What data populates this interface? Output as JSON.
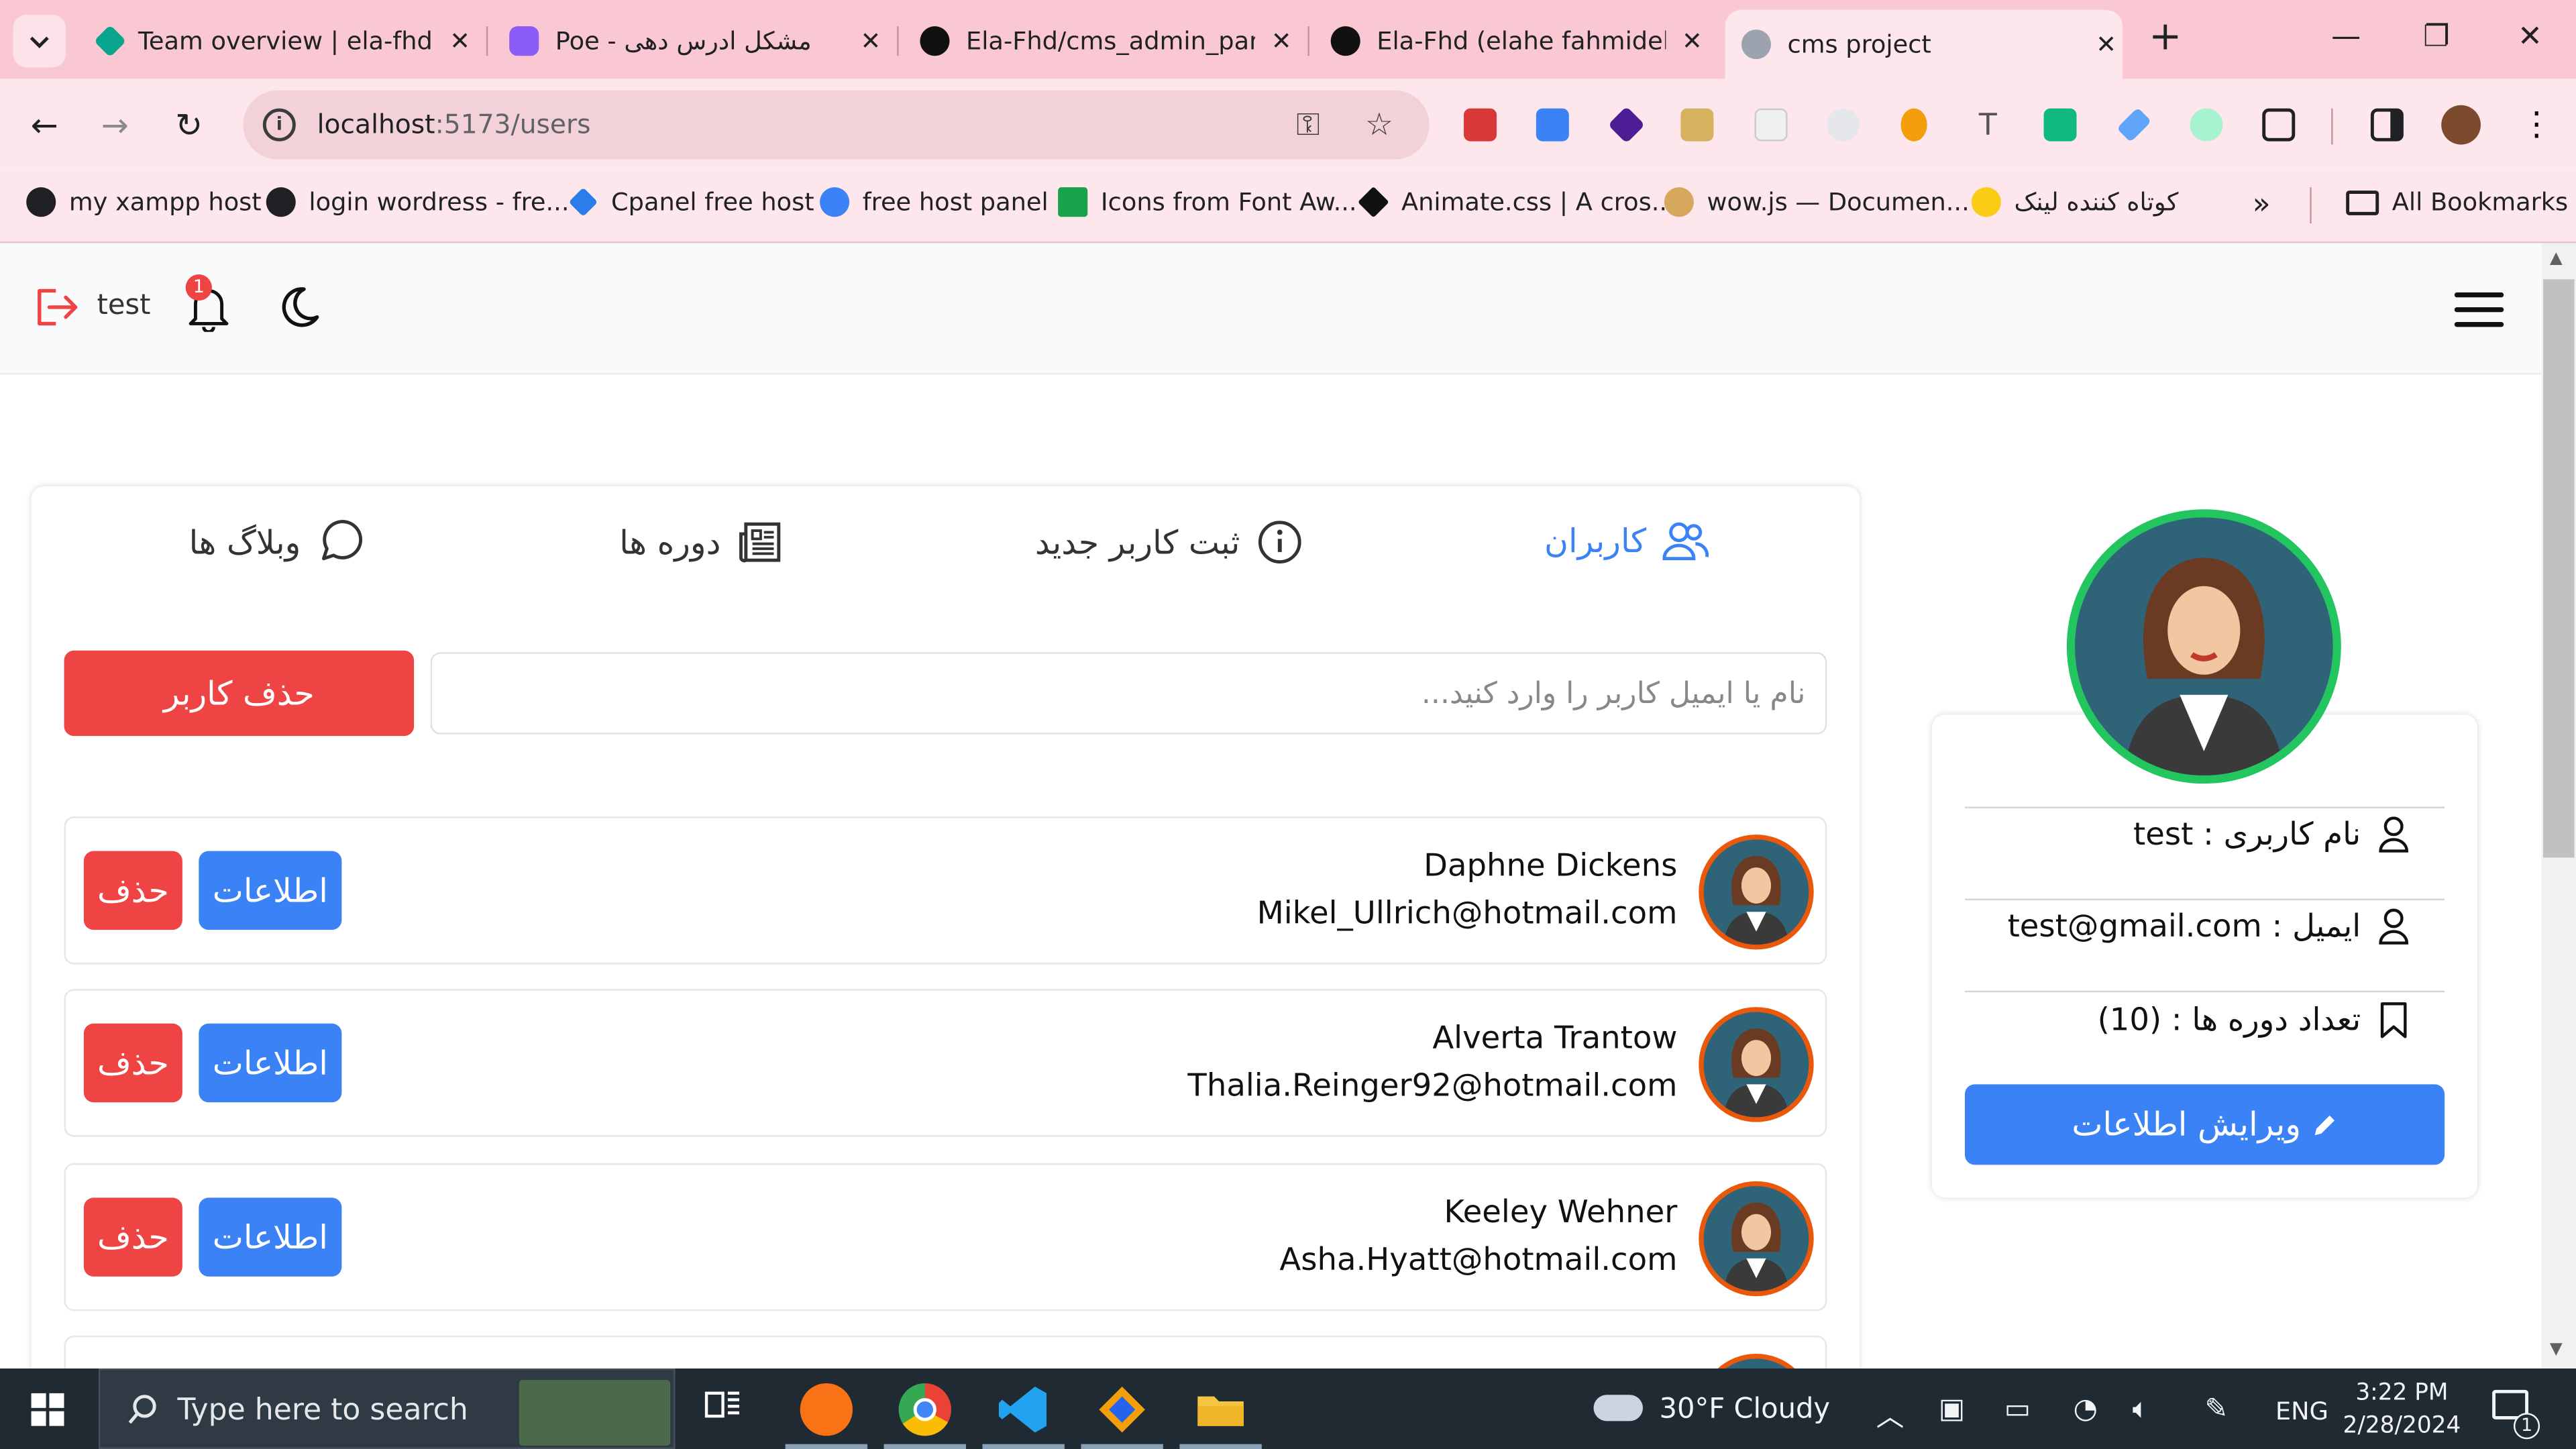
{
  "browser": {
    "tabs": [
      {
        "title": "Team overview | ela-fhd |",
        "color": "#0aa58f"
      },
      {
        "title": "Poe - مشکل ادرس دهی",
        "color": "#8b5cf6"
      },
      {
        "title": "Ela-Fhd/cms_admin_pane",
        "color": "#111111"
      },
      {
        "title": "Ela-Fhd (elahe fahmideh)",
        "color": "#111111"
      },
      {
        "title": "cms project",
        "color": "#9ca3af"
      }
    ],
    "url_host": "localhost",
    "url_path": ":5173/users",
    "bookmarks": [
      "my xampp host",
      "login wordress - fre...",
      "Cpanel free host",
      "free host panel",
      "Icons from Font Aw...",
      "Animate.css | A cros...",
      "wow.js — Documen...",
      "کوتاه کننده لینک"
    ],
    "all_bookmarks": "All Bookmarks",
    "overflow": "»"
  },
  "header": {
    "username": "test",
    "notification_count": "1"
  },
  "tabs": {
    "users": "کاربران",
    "new_user": "ثبت کاربر جدید",
    "courses": "دوره ها",
    "blogs": "وبلاگ ها"
  },
  "search": {
    "placeholder": "نام یا ایمیل کاربر را وارد کنید...",
    "delete_user": "حذف کاربر"
  },
  "users": [
    {
      "name": "Daphne Dickens",
      "email": "Mikel_Ullrich@hotmail.com",
      "info": "اطلاعات",
      "delete": "حذف"
    },
    {
      "name": "Alverta Trantow",
      "email": "Thalia.Reinger92@hotmail.com",
      "info": "اطلاعات",
      "delete": "حذف"
    },
    {
      "name": "Keeley Wehner",
      "email": "Asha.Hyatt@hotmail.com",
      "info": "اطلاعات",
      "delete": "حذف"
    }
  ],
  "profile": {
    "username_line": "نام کاربری : test",
    "email_line": "ایمیل : test@gmail.com",
    "courses_line": "تعداد دوره ها : (10)",
    "edit_button": "ویرایش اطلاعات"
  },
  "taskbar": {
    "search_placeholder": "Type here to search",
    "weather": "30°F  Cloudy",
    "lang": "ENG",
    "time": "3:22 PM",
    "date": "2/28/2024",
    "notifications": "1"
  },
  "colors": {
    "accent": "#3b82f6",
    "danger": "#ef4444",
    "avatar_ring_profile": "#22c55e",
    "avatar_ring_user": "#ea580c"
  }
}
